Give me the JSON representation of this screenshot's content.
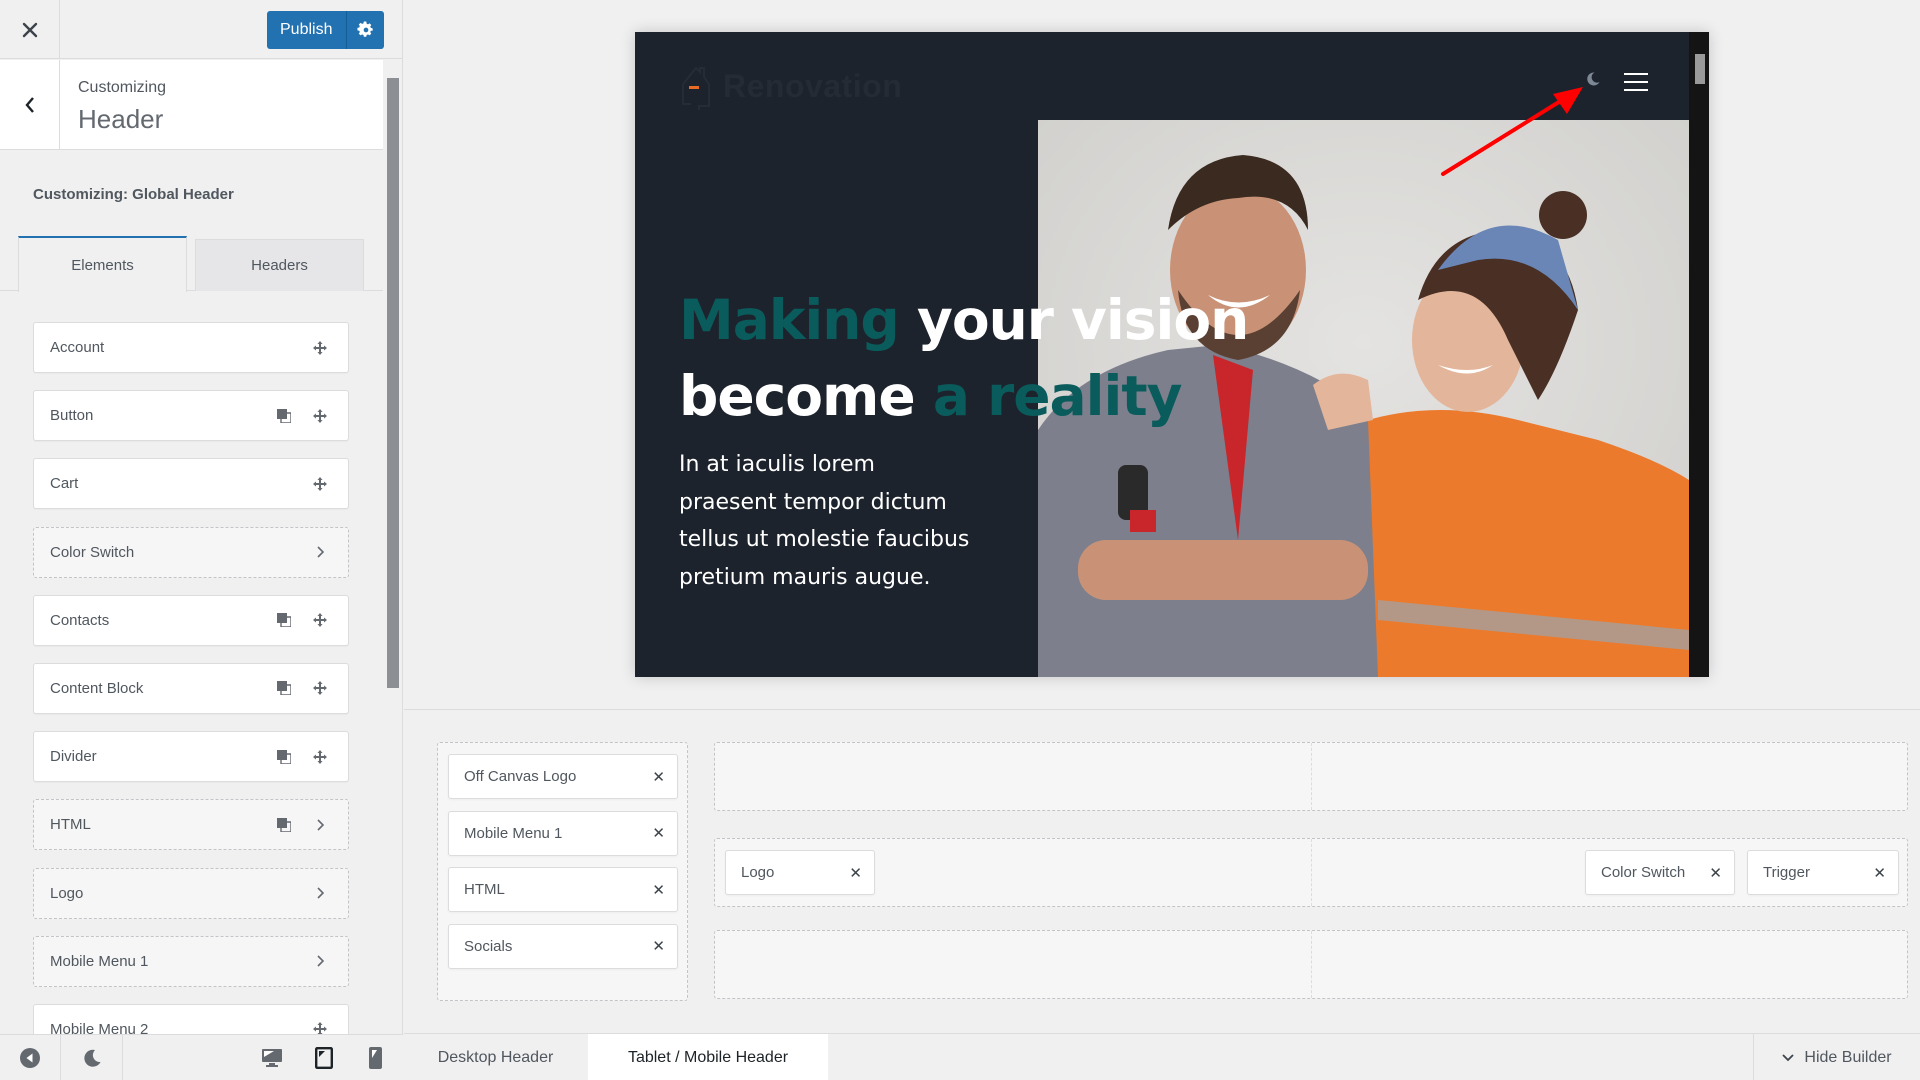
{
  "topbar": {
    "close_label": "Close",
    "publish_label": "Publish"
  },
  "section": {
    "subtitle": "Customizing",
    "title": "Header"
  },
  "panel": {
    "global_label": "Customizing: Global Header",
    "tabs": [
      {
        "label": "Elements",
        "active": true
      },
      {
        "label": "Headers",
        "active": false
      }
    ],
    "elements": [
      {
        "label": "Account",
        "style": "solid",
        "icons": [
          "move-icon"
        ]
      },
      {
        "label": "Button",
        "style": "solid",
        "icons": [
          "duplicate-icon",
          "move-icon"
        ]
      },
      {
        "label": "Cart",
        "style": "solid",
        "icons": [
          "move-icon"
        ]
      },
      {
        "label": "Color Switch",
        "style": "dashed",
        "icons": [
          "chevron-right-icon"
        ]
      },
      {
        "label": "Contacts",
        "style": "solid",
        "icons": [
          "duplicate-icon",
          "move-icon"
        ]
      },
      {
        "label": "Content Block",
        "style": "solid",
        "icons": [
          "duplicate-icon",
          "move-icon"
        ]
      },
      {
        "label": "Divider",
        "style": "solid",
        "icons": [
          "duplicate-icon",
          "move-icon"
        ]
      },
      {
        "label": "HTML",
        "style": "dashed",
        "icons": [
          "duplicate-icon",
          "chevron-right-icon"
        ]
      },
      {
        "label": "Logo",
        "style": "dashed",
        "icons": [
          "chevron-right-icon"
        ]
      },
      {
        "label": "Mobile Menu 1",
        "style": "dashed",
        "icons": [
          "chevron-right-icon"
        ]
      },
      {
        "label": "Mobile Menu 2",
        "style": "solid",
        "icons": [
          "move-icon"
        ]
      }
    ],
    "footer_icons": [
      "collapse-icon",
      "dark-mode-icon",
      "desktop-icon",
      "tablet-icon",
      "mobile-icon"
    ]
  },
  "preview": {
    "site_name": "Renovation",
    "hero_title": {
      "line1_accent": "Making",
      "line1_rest": " your vision",
      "line2_start": "become ",
      "line2_accent": "a reality"
    },
    "hero_text": "In at iaculis lorem praesent tempor dictum tellus ut molestie faucibus pretium mauris augue.",
    "colors": {
      "accent": "#0a5c5c",
      "background": "#1d232c",
      "logo_accent": "#e86a24",
      "annotation_arrow": "#ff0000"
    }
  },
  "builder": {
    "off_canvas": [
      "Off Canvas Logo",
      "Mobile Menu 1",
      "HTML",
      "Socials"
    ],
    "rows": [
      {
        "left": [],
        "right": []
      },
      {
        "left": [
          "Logo"
        ],
        "right": [
          "Color Switch",
          "Trigger"
        ]
      },
      {
        "left": [],
        "right": []
      }
    ],
    "tabs": [
      {
        "label": "Desktop Header",
        "active": false
      },
      {
        "label": "Tablet / Mobile Header",
        "active": true
      }
    ],
    "hide_label": "Hide Builder"
  }
}
